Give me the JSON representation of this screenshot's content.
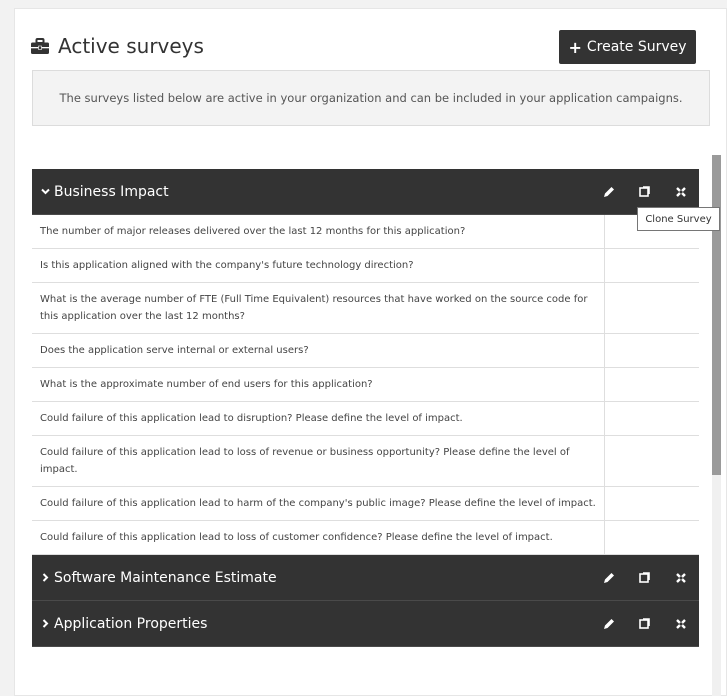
{
  "header": {
    "title": "Active surveys",
    "title_icon": "briefcase-icon",
    "create_button_label": "Create Survey",
    "create_button_icon": "plus-icon"
  },
  "info": {
    "text": "The surveys listed below are active in your organization and can be included in your application campaigns."
  },
  "sections": [
    {
      "title": "Business Impact",
      "expanded": true,
      "actions": [
        "edit-icon",
        "clone-icon",
        "delete-icon"
      ],
      "questions": [
        "The number of major releases delivered over the last 12 months for this application?",
        "Is this application aligned with the company's future technology direction?",
        "What is the average number of FTE (Full Time Equivalent) resources that have worked on the source code for this application over the last 12 months?",
        "Does the application serve internal or external users?",
        "What is the approximate number of end users for this application?",
        "Could failure of this application lead to disruption? Please define the level of impact.",
        "Could failure of this application lead to loss of revenue or business opportunity? Please define the level of impact.",
        "Could failure of this application lead to harm of the company's public image? Please define the level of impact.",
        "Could failure of this application lead to loss of customer confidence? Please define the level of impact."
      ]
    },
    {
      "title": "Software Maintenance Estimate",
      "expanded": false,
      "actions": [
        "edit-icon",
        "clone-icon",
        "delete-icon"
      ]
    },
    {
      "title": "Application Properties",
      "expanded": false,
      "actions": [
        "edit-icon",
        "clone-icon",
        "delete-icon"
      ]
    }
  ],
  "tooltip": {
    "text": "Clone Survey"
  },
  "colors": {
    "section_header_bg": "#333333",
    "panel_bg": "#ffffff",
    "info_bg": "#f3f3f3"
  }
}
